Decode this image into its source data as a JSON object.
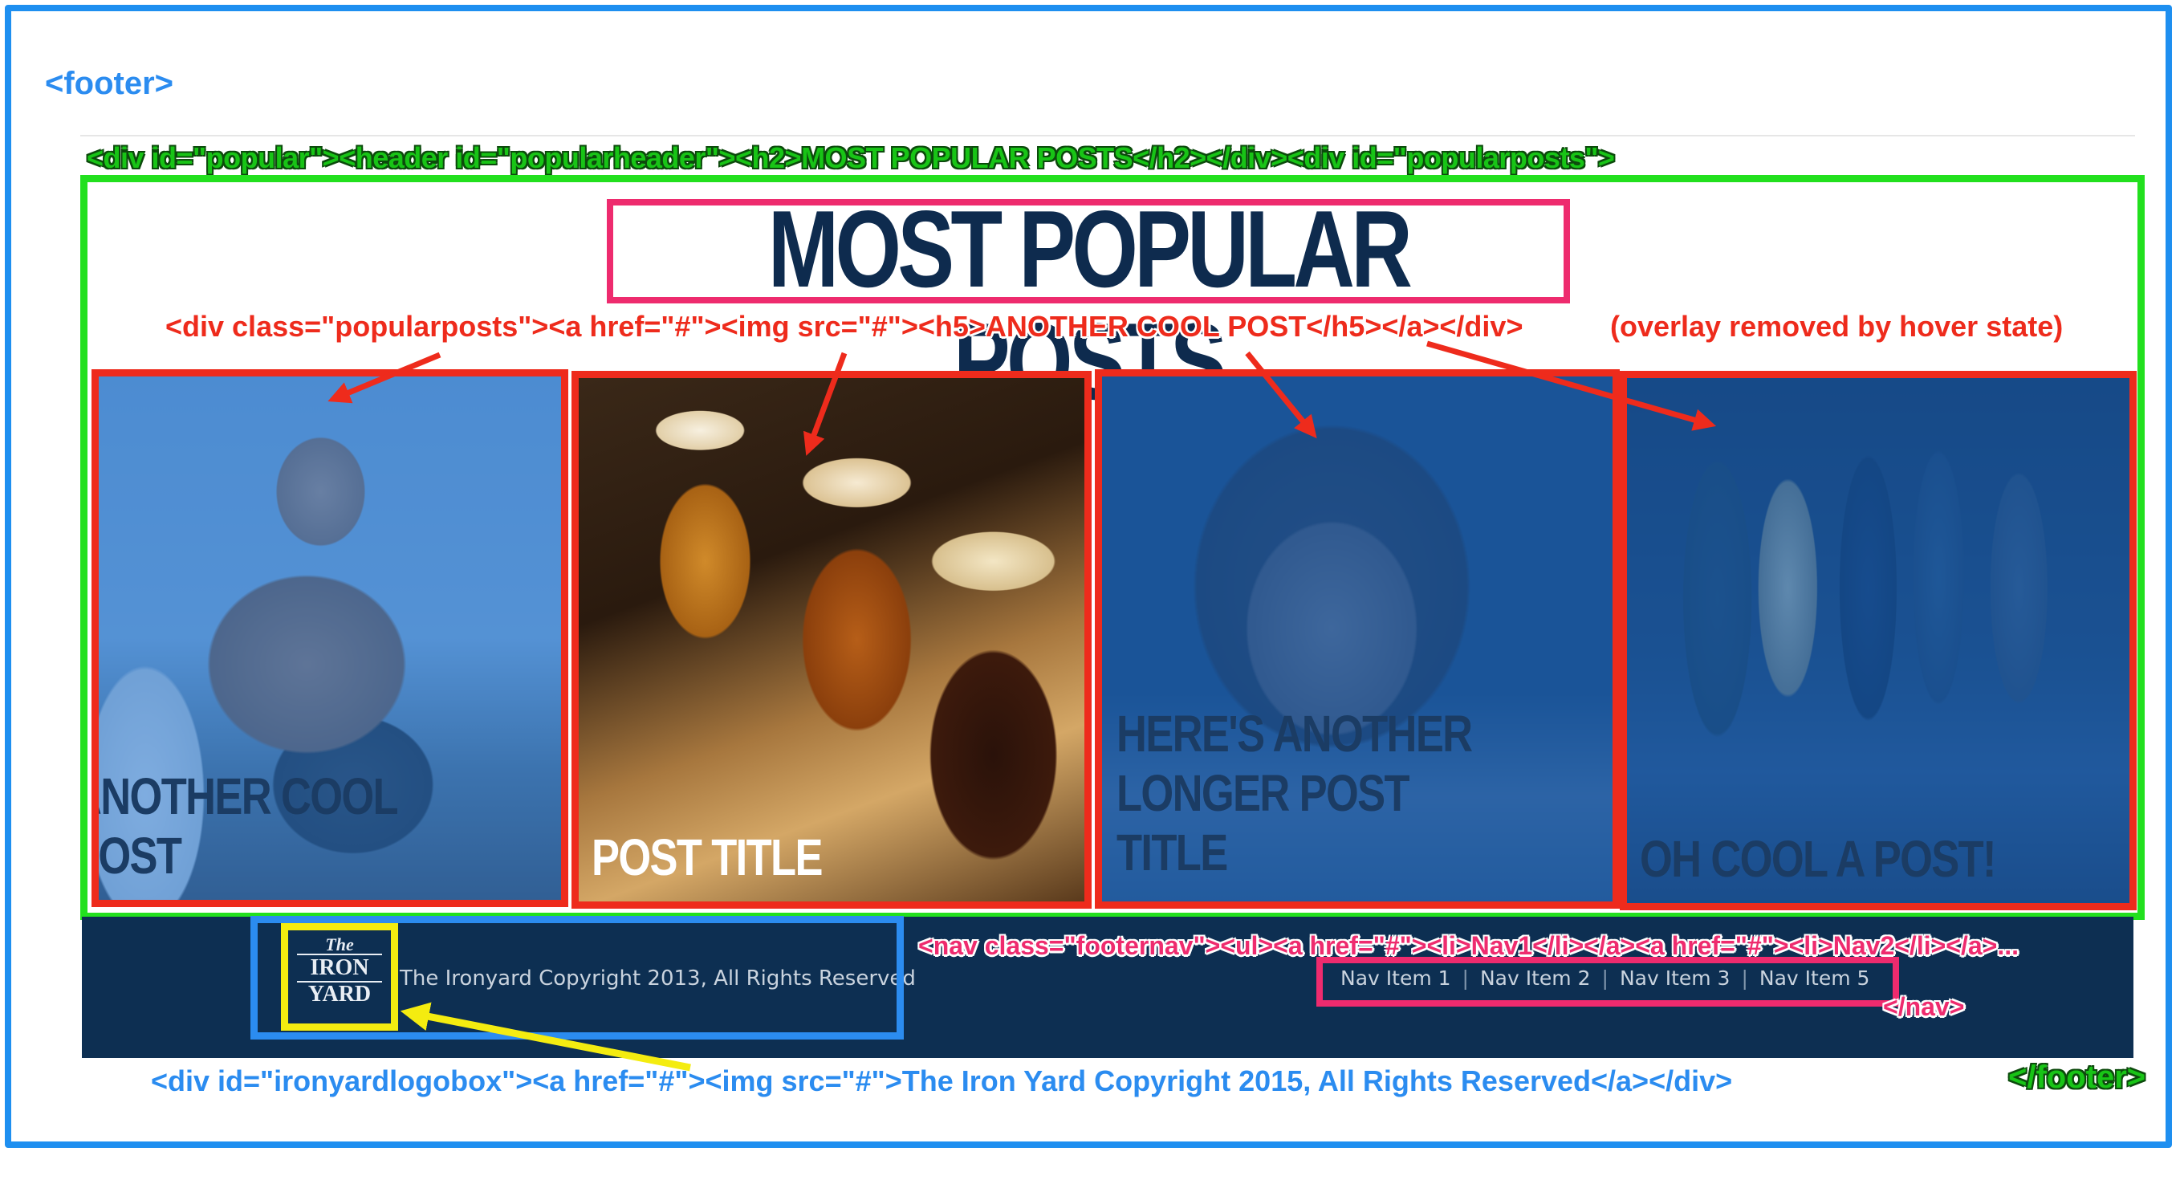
{
  "annotations": {
    "footer_open": "<footer>",
    "popular_code": "<div id=\"popular\"><header id=\"popularheader\"><h2>MOST POPULAR POSTS</h2></div><div id=\"popularposts\">",
    "posts_code": "<div class=\"popularposts\"><a href=\"#\"><img src=\"#\"><h5>ANOTHER COOL POST</h5></a></div>",
    "overlay_note": "(overlay removed by hover state)",
    "nav_code": "<nav class=\"footernav\"><ul><a href=\"#\"><li>Nav1</li></a><a href=\"#\"><li>Nav2</li></a>...",
    "nav_close": "</nav>",
    "logobox_code": "<div id=\"ironyardlogobox\"><a href=\"#\"><img src=\"#\">The Iron Yard Copyright 2015, All Rights Reserved</a></div>",
    "footer_close": "</footer>"
  },
  "popular": {
    "title": "MOST POPULAR POSTS",
    "posts": [
      {
        "title": "ANOTHER COOL POST"
      },
      {
        "title": "POST TITLE"
      },
      {
        "title": "HERE'S ANOTHER\nLONGER POST TITLE"
      },
      {
        "title": "OH COOL A POST!"
      }
    ]
  },
  "footer": {
    "logo": {
      "line1": "The",
      "line2": "IRON",
      "line3": "YARD"
    },
    "copyright": "The Ironyard Copyright 2013, All Rights Reserved",
    "nav_items": [
      "Nav Item 1",
      "Nav Item 2",
      "Nav Item 3",
      "Nav Item 5"
    ],
    "nav_separator": "|"
  },
  "colors": {
    "annotation_blue": "#2b8cf0",
    "annotation_green": "#22e01e",
    "annotation_red": "#ee2b1c",
    "annotation_pink": "#ee2b6e",
    "annotation_yellow": "#f4ec10",
    "title_navy": "#0e2b4e",
    "footer_navy": "#0d2f52"
  }
}
